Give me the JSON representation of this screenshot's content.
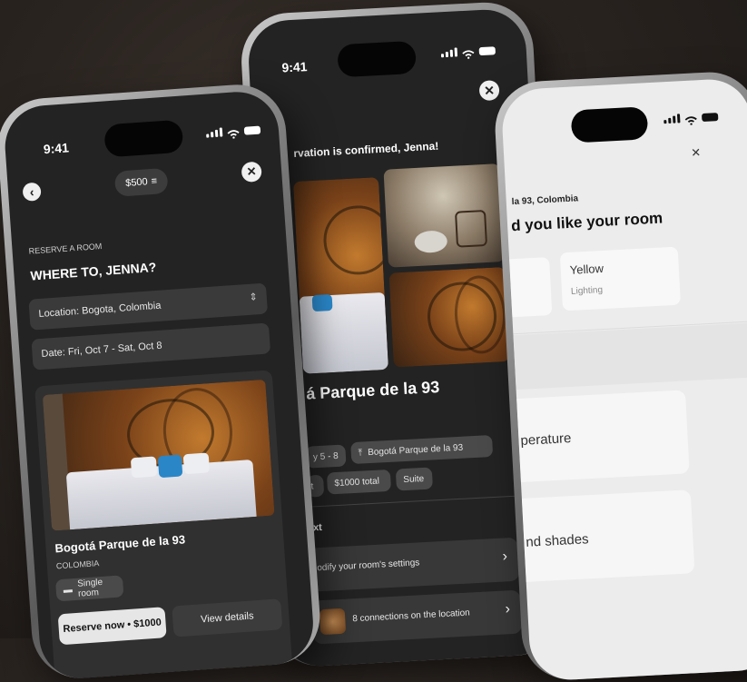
{
  "status_time": "9:41",
  "phone1": {
    "balance": "$500",
    "section_label": "RESERVE A ROOM",
    "heading": "WHERE TO, JENNA?",
    "location_field": "Location: Bogota, Colombia",
    "date_field": "Date: Fri, Oct 7 - Sat, Oct 8",
    "hotel_name": "Bogotá Parque de la 93",
    "country": "COLOMBIA",
    "room_type_chip": "Single room",
    "reserve_button": "Reserve now • $1000",
    "details_button": "View details"
  },
  "phone2": {
    "confirmation": "rvation is confirmed, Jenna!",
    "hotel_name": "á Parque de la 93",
    "chip_dates": "y 5 - 8",
    "chip_location": "Bogotá Parque de la 93",
    "chip_partial": "t",
    "chip_total": "$1000 total",
    "chip_suite": "Suite",
    "section_next": "xt",
    "row_settings": "odify your room's settings",
    "row_connections": "8 connections on the location"
  },
  "phone3": {
    "location": "la 93, Colombia",
    "heading": "d you like your room",
    "option_yellow_title": "Yellow",
    "option_yellow_sub": "Lighting",
    "row_temperature": "perature",
    "row_shades": "nd shades"
  },
  "colors": {
    "dark_screen": "#232323",
    "light_screen": "#ececec",
    "chip": "#4a4a4a",
    "field": "#3a3a3a"
  }
}
